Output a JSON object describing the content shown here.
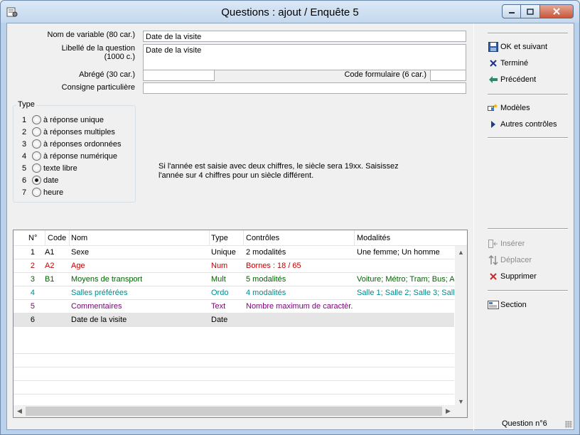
{
  "window": {
    "title": "Questions : ajout / Enquête 5"
  },
  "form": {
    "var_name_label": "Nom de variable (80 car.)",
    "var_name_value": "Date de la visite",
    "question_label_line1": "Libellé de la question",
    "question_label_line2": "(1000 c.)",
    "question_value": "Date de la visite",
    "abbrev_label": "Abrégé (30 car.)",
    "abbrev_value": "",
    "form_code_label": "Code formulaire  (6 car.)",
    "form_code_value": "",
    "instruction_label": "Consigne particulière",
    "instruction_value": ""
  },
  "type_group": {
    "title": "Type",
    "options": [
      {
        "num": "1",
        "label": "à réponse unique",
        "checked": false
      },
      {
        "num": "2",
        "label": "à réponses multiples",
        "checked": false
      },
      {
        "num": "3",
        "label": "à réponses ordonnées",
        "checked": false
      },
      {
        "num": "4",
        "label": "à réponse numérique",
        "checked": false
      },
      {
        "num": "5",
        "label": "texte libre",
        "checked": false
      },
      {
        "num": "6",
        "label": "date",
        "checked": true
      },
      {
        "num": "7",
        "label": "heure",
        "checked": false
      }
    ]
  },
  "help": {
    "line1": "Si l'année est saisie avec deux chiffres, le siècle sera 19xx. Saisissez",
    "line2": "l'année sur 4 chiffres pour un siècle différent."
  },
  "sidebar": {
    "ok_next": "OK et suivant",
    "done": "Terminé",
    "previous": "Précédent",
    "models": "Modèles",
    "other_controls": "Autres contrôles",
    "insert": "Insérer",
    "move": "Déplacer",
    "delete": "Supprimer",
    "section": "Section"
  },
  "grid": {
    "columns": [
      "N°",
      "Code",
      "Nom",
      "Type",
      "Contrôles",
      "Modalités"
    ],
    "rows": [
      {
        "num": "1",
        "code": "A1",
        "name": "Sexe",
        "type": "Unique",
        "controls": "2 modalités",
        "modalities": "Une femme; Un homme",
        "color": "#000000"
      },
      {
        "num": "2",
        "code": "A2",
        "name": "Age",
        "type": "Num",
        "controls": "Bornes : 18 / 65",
        "modalities": "",
        "color": "#c00000"
      },
      {
        "num": "3",
        "code": "B1",
        "name": "Moyens de transport",
        "type": "Mult",
        "controls": "5 modalités",
        "modalities": "Voiture; Métro; Tram; Bus; A",
        "color": "#006400"
      },
      {
        "num": "4",
        "code": "",
        "name": "Salles préférées",
        "type": "Ordo",
        "controls": "4 modalités",
        "modalities": "Salle 1; Salle 2; Salle 3; Salle",
        "color": "#008b8b"
      },
      {
        "num": "5",
        "code": "",
        "name": "Commentaires",
        "type": "Text",
        "controls": "Nombre maximum de caractèr...",
        "modalities": "",
        "color": "#800080"
      },
      {
        "num": "6",
        "code": "",
        "name": "Date de la visite",
        "type": "Date",
        "controls": "",
        "modalities": "",
        "color": "#000000"
      }
    ]
  },
  "status": {
    "text": "Question n°6"
  }
}
